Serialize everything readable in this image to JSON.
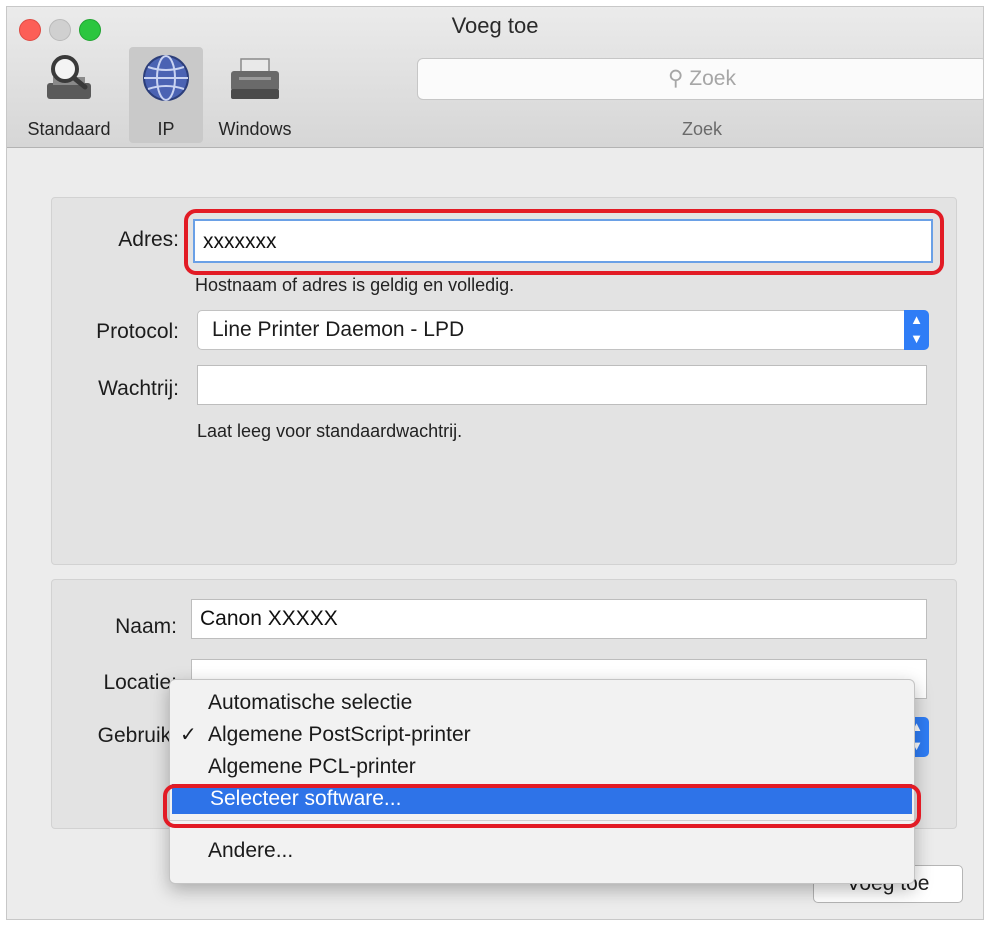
{
  "window": {
    "title": "Voeg toe"
  },
  "toolbar": {
    "items": [
      {
        "label": "Standaard",
        "icon": "magnifier-printer-icon"
      },
      {
        "label": "IP",
        "icon": "globe-icon",
        "selected": true
      },
      {
        "label": "Windows",
        "icon": "printer-icon"
      }
    ],
    "search_placeholder": "Zoek",
    "search_label": "Zoek"
  },
  "ip_panel": {
    "address_label": "Adres:",
    "address_value": "xxxxxxx",
    "address_hint": "Hostnaam of adres is geldig en volledig.",
    "protocol_label": "Protocol:",
    "protocol_value": "Line Printer Daemon - LPD",
    "queue_label": "Wachtrij:",
    "queue_value": "",
    "queue_hint": "Laat leeg voor standaardwachtrij."
  },
  "printer_panel": {
    "name_label": "Naam:",
    "name_value": "Canon XXXXX",
    "location_label": "Locatie:",
    "location_value": "",
    "use_label": "Gebruik:"
  },
  "use_menu": {
    "items": [
      {
        "label": "Automatische selectie",
        "checked": false
      },
      {
        "label": "Algemene PostScript-printer",
        "checked": true
      },
      {
        "label": "Algemene PCL-printer",
        "checked": false
      },
      {
        "label": "Selecteer software...",
        "highlighted": true
      },
      {
        "label": "Andere..."
      }
    ],
    "check_glyph": "✓"
  },
  "add_button_label": "Voeg toe",
  "colors": {
    "highlight": "#2e73e8",
    "annotation_red": "#e21b25",
    "accent_blue": "#2f7df6"
  }
}
